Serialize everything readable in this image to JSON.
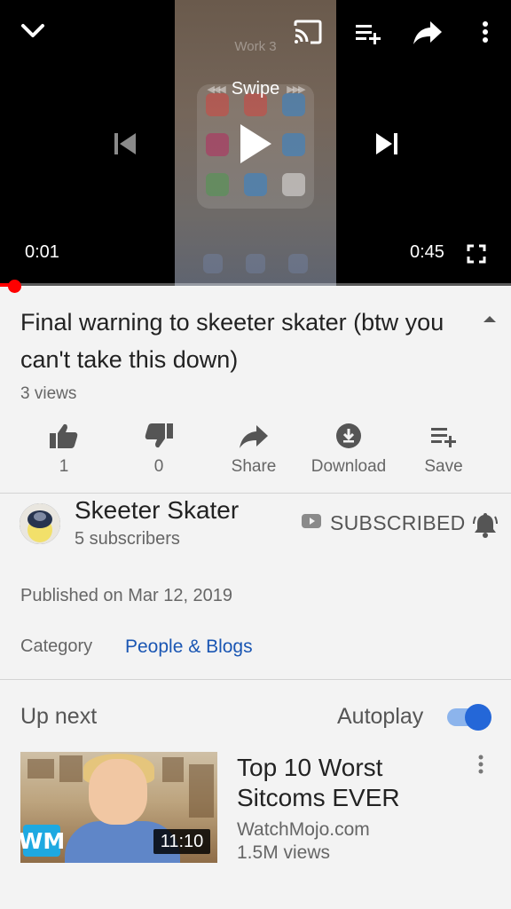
{
  "player": {
    "frame_label": "Work 3",
    "swipe_hint": "Swipe",
    "current_time": "0:01",
    "duration": "0:45",
    "progress": 0.02
  },
  "video": {
    "title": "Final warning to skeeter skater (btw you can't take this down)",
    "views": "3 views",
    "actions": {
      "like": "1",
      "dislike": "0",
      "share": "Share",
      "download": "Download",
      "save": "Save"
    }
  },
  "channel": {
    "name": "Skeeter Skater",
    "subscribers": "5 subscribers",
    "subscribe_state": "SUBSCRIBED"
  },
  "details": {
    "published": "Published on Mar 12, 2019",
    "category_label": "Category",
    "category_value": "People & Blogs"
  },
  "up_next": {
    "heading": "Up next",
    "autoplay_label": "Autoplay",
    "autoplay_on": true,
    "item": {
      "title": "Top 10 Worst Sitcoms EVER",
      "channel": "WatchMojo.com",
      "views": "1.5M views",
      "duration": "11:10",
      "logo_text": "WM"
    }
  },
  "colors": {
    "progress": "#ff0000",
    "link": "#1a56b3",
    "toggle": "#2467d8"
  },
  "icons": [
    "chevron-down-icon",
    "cast-icon",
    "add-to-queue-icon",
    "share-icon",
    "more-vert-icon",
    "skip-previous-icon",
    "play-icon",
    "skip-next-icon",
    "fullscreen-icon",
    "thumb-up-icon",
    "thumb-down-icon",
    "download-icon",
    "save-icon",
    "youtube-icon",
    "bell-icon"
  ]
}
